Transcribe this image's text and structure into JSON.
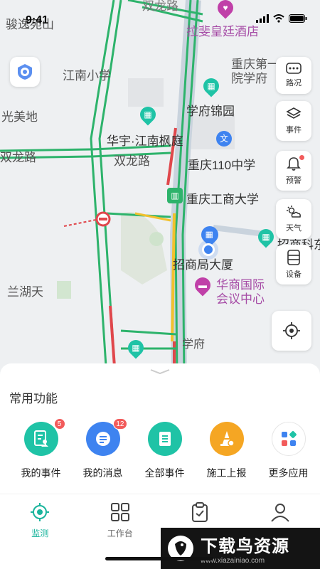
{
  "status": {
    "time": "9:41"
  },
  "map": {
    "labels": {
      "junjing": "骏逸苑山",
      "shuanglong_top": "双龙路",
      "lafei": "拉斐皇廷酒店",
      "jiangnan": "江南小学",
      "chongqing_di": "重庆第一",
      "xuefu_f": "院学府",
      "xuefu_jinyuan": "学府锦园",
      "guangmei": "光美地",
      "huayu": "华宇·江南枫庭",
      "shuanglong_left": "双龙路",
      "shuanglong_mid": "双龙路",
      "cq110": "重庆110中学",
      "ctbu": "重庆工商大学",
      "zhaoshang": "招商局大厦",
      "zhaoshang_ke": "招商科东",
      "huashang1": "华商国际",
      "huashang2": "会议中心",
      "lanhu": "兰湖天",
      "xuefu_road": "学府"
    }
  },
  "side_buttons": {
    "traffic": "路况",
    "events": "事件",
    "alert": "预警",
    "weather": "天气",
    "device": "设备"
  },
  "sheet": {
    "title": "常用功能",
    "funcs": [
      {
        "label": "我的事件",
        "badge": "5",
        "color": "#1fc3a6"
      },
      {
        "label": "我的消息",
        "badge": "12",
        "color": "#3e83f0"
      },
      {
        "label": "全部事件",
        "badge": "",
        "color": "#1fc3a6"
      },
      {
        "label": "施工上报",
        "badge": "",
        "color": "#f5a623"
      },
      {
        "label": "更多应用",
        "badge": "",
        "color": "#ffffff"
      }
    ]
  },
  "tabs": [
    {
      "label": "监测",
      "active": true
    },
    {
      "label": "工作台",
      "active": false
    },
    {
      "label": "",
      "active": false
    },
    {
      "label": "",
      "active": false
    }
  ],
  "watermark": {
    "main": "下载鸟资源",
    "sub": "www.xiazainiao.com"
  },
  "colors": {
    "accent": "#19b49c",
    "road_green": "#2db36b",
    "road_red": "#e0474c",
    "road_yellow": "#f2c12e"
  }
}
